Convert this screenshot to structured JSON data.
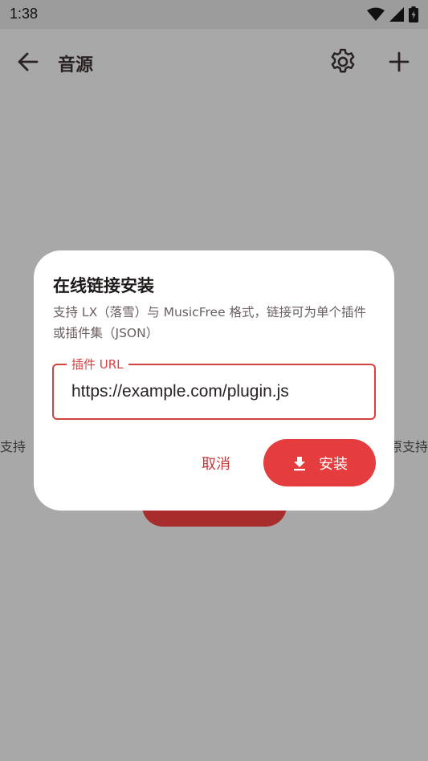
{
  "status": {
    "time": "1:38"
  },
  "appbar": {
    "title": "音源"
  },
  "background": {
    "left_text": "支持",
    "right_text": "原支持"
  },
  "dialog": {
    "title": "在线链接安装",
    "description": "支持 LX（落雪）与 MusicFree 格式，链接可为单个插件或插件集（JSON）",
    "field_label": "插件 URL",
    "field_value": "https://example.com/plugin.js",
    "cancel_label": "取消",
    "install_label": "安装"
  }
}
